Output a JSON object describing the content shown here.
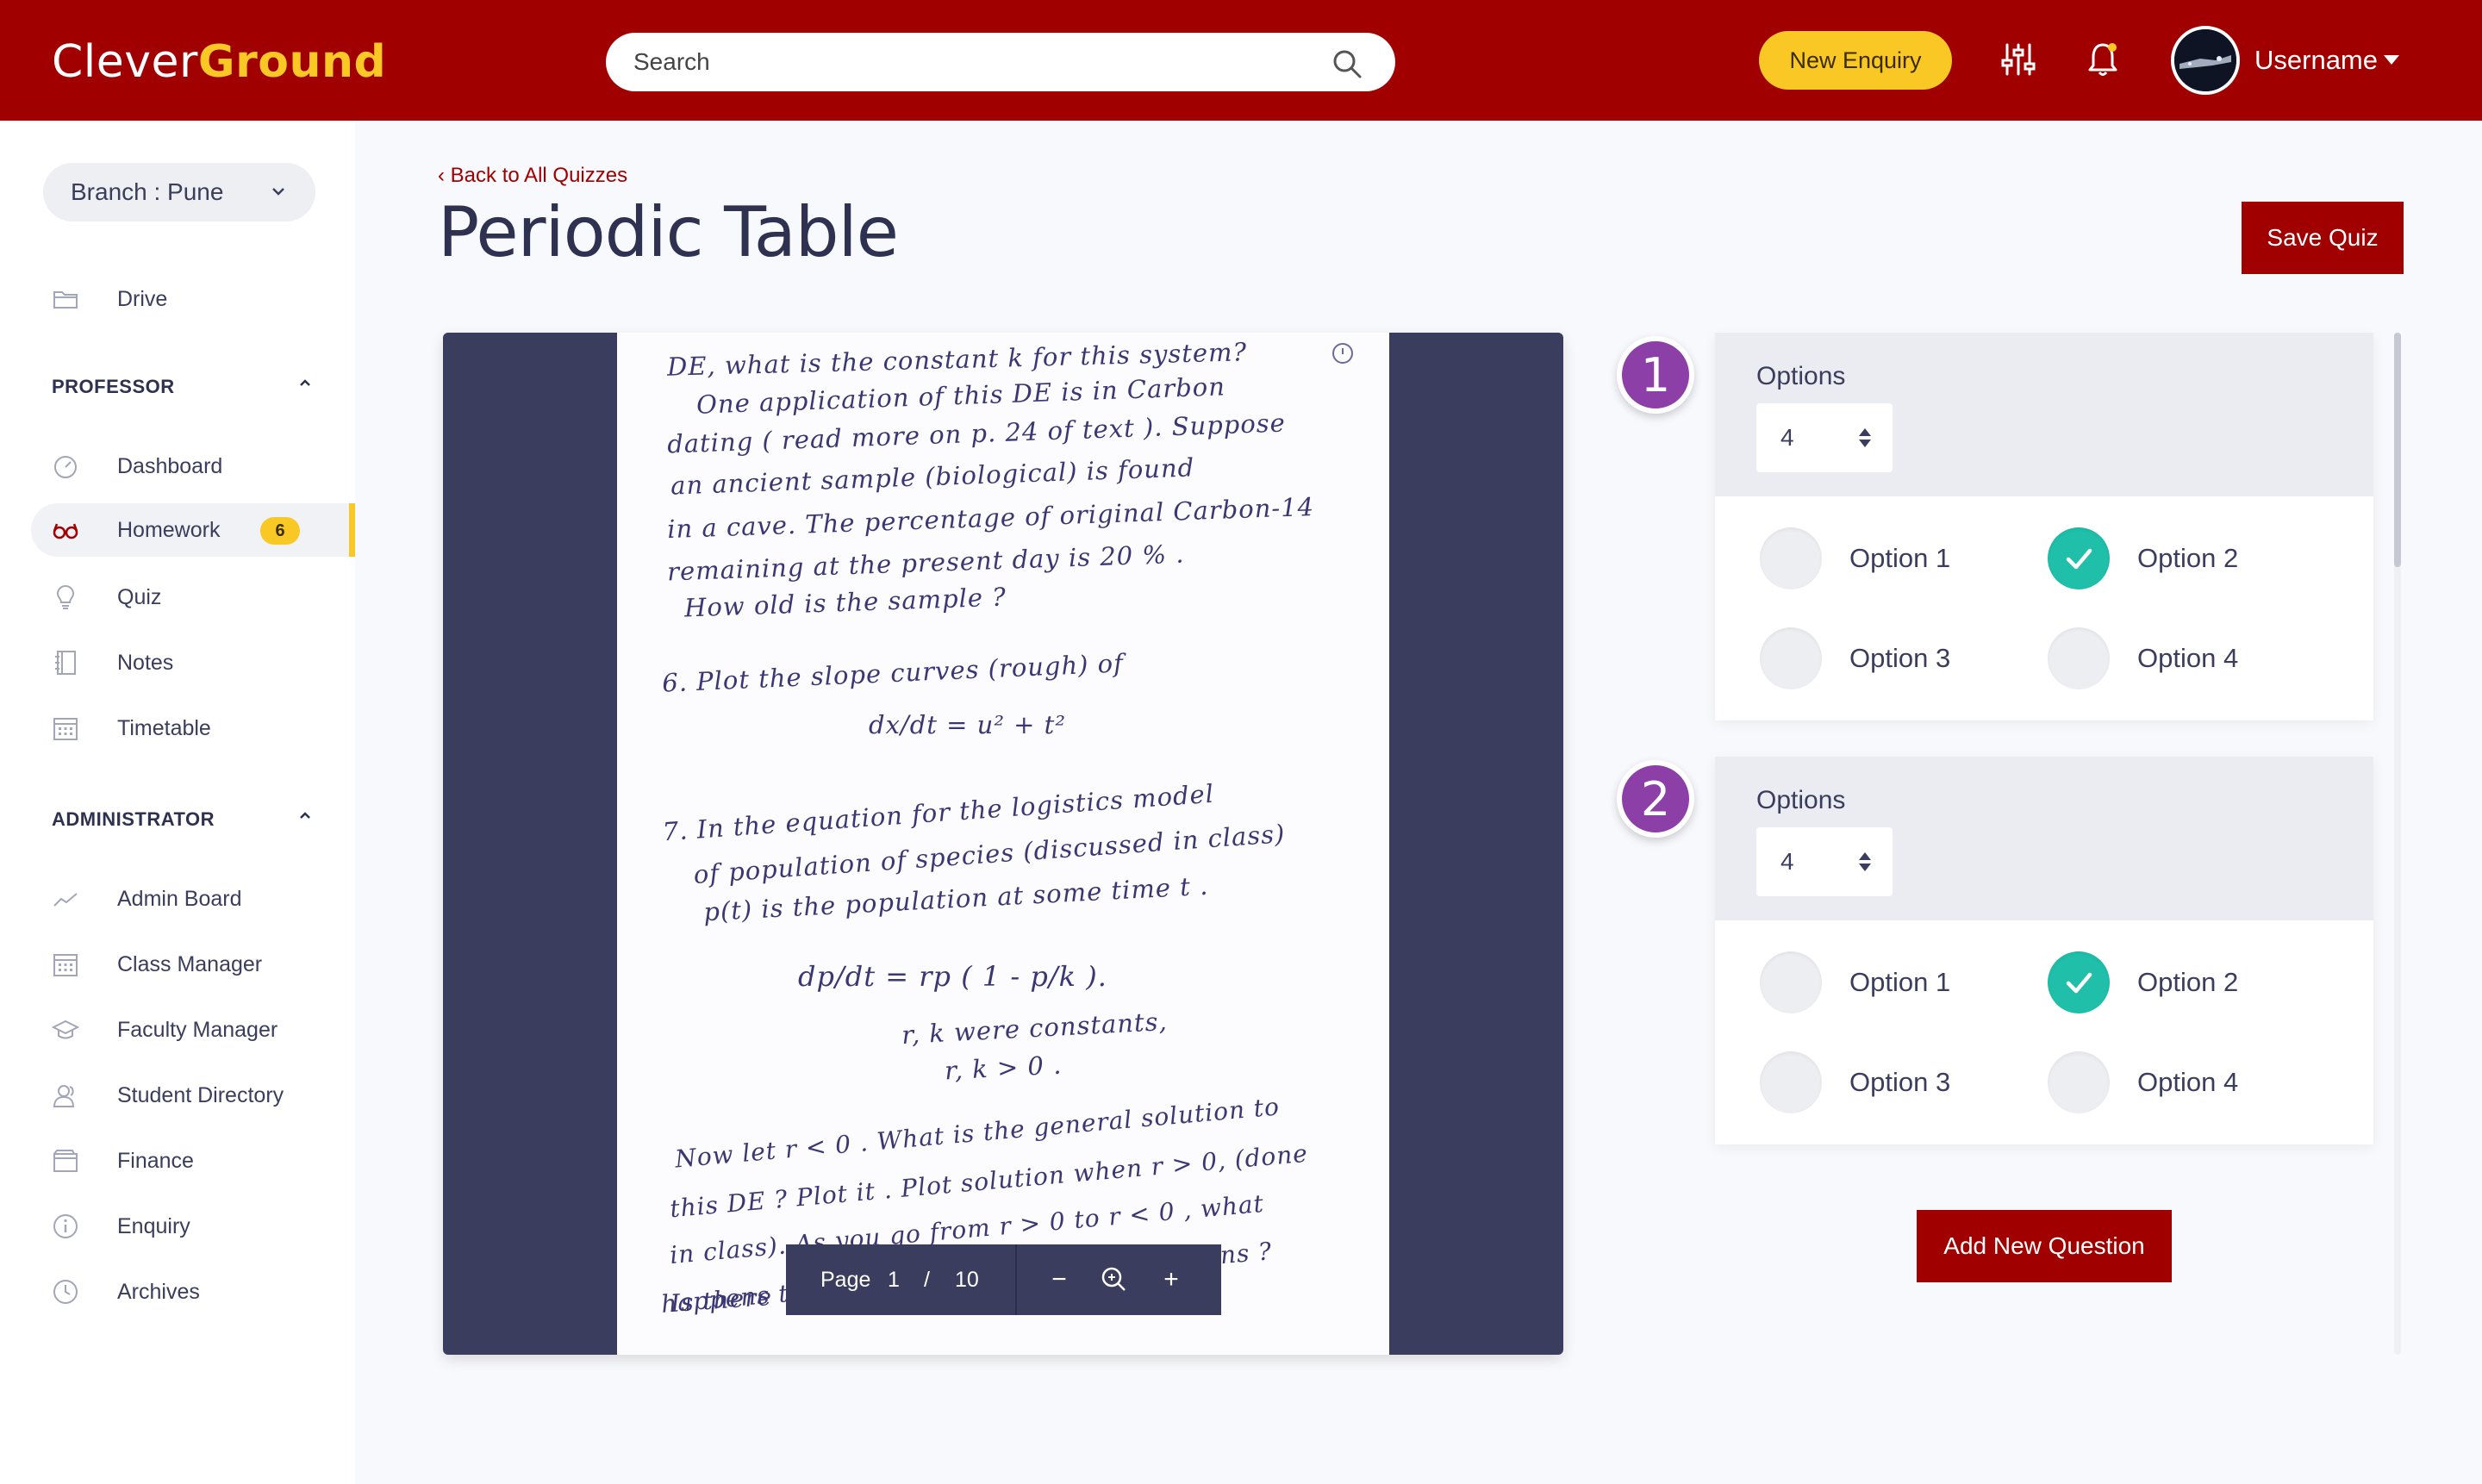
{
  "header": {
    "logo_part1": "Clever",
    "logo_part2": "Ground",
    "search_placeholder": "Search",
    "new_enquiry_label": "New Enquiry",
    "username": "Username"
  },
  "sidebar": {
    "branch_label": "Branch : Pune",
    "drive_label": "Drive",
    "professor_heading": "PROFESSOR",
    "professor_items": [
      {
        "label": "Dashboard",
        "icon": "gauge-icon"
      },
      {
        "label": "Homework",
        "icon": "glasses-icon",
        "badge": "6",
        "active": true
      },
      {
        "label": "Quiz",
        "icon": "lightbulb-icon"
      },
      {
        "label": "Notes",
        "icon": "notebook-icon"
      },
      {
        "label": "Timetable",
        "icon": "calendar-icon"
      }
    ],
    "administrator_heading": "ADMINISTRATOR",
    "admin_items": [
      {
        "label": "Admin Board",
        "icon": "trend-icon"
      },
      {
        "label": "Class Manager",
        "icon": "calendar-grid-icon"
      },
      {
        "label": "Faculty Manager",
        "icon": "graduation-cap-icon"
      },
      {
        "label": "Student Directory",
        "icon": "users-icon"
      },
      {
        "label": "Finance",
        "icon": "wallet-icon"
      },
      {
        "label": "Enquiry",
        "icon": "info-icon"
      },
      {
        "label": "Archives",
        "icon": "clock-icon"
      }
    ]
  },
  "main": {
    "back_link": "Back to All Quizzes",
    "title": "Periodic Table",
    "save_label": "Save Quiz",
    "add_question_label": "Add New Question"
  },
  "viewer": {
    "page_label": "Page",
    "current_page": "1",
    "page_sep": "/",
    "total_pages": "10",
    "handwriting": [
      "DE,  what  is  the  constant  k  for  this  system?",
      "One  application  of  this  DE  is  in  Carbon",
      "dating  ( read  more  on p. 24  of  text ).  Suppose",
      "an  ancient  sample  (biological)  is  found",
      "in a  cave.  The  percentage  of  original  Carbon-14",
      "remaining  at  the  present  day  is  20 % .",
      "How  old  is  the  sample ?",
      "6.      Plot  the    slope  curves   (rough)   of",
      "dx/dt  =  u² + t²",
      "7.   In   the  equation   for  the   logistics  model",
      "of  population   of  species   (discussed  in  class)",
      "p(t)  is  the  population    at  some  time t .",
      "dp/dt   =   rp  ( 1 - p/k ).",
      "r, k    were  constants,",
      "r, k > 0 .",
      "Now   let   r < 0 .   What  is the general  solution  to",
      "this  DE ?   Plot  it .   Plot  solution   when  r > 0, (done",
      "in class).   As  you  go   from   r > 0  to  r < 0 ,  what",
      "happens   to  qualitative  behaviour   of  solutions ?",
      "Is  there"
    ]
  },
  "questions": [
    {
      "number": "1",
      "options_label": "Options",
      "options_count": "4",
      "options": [
        {
          "label": "Option 1",
          "checked": false
        },
        {
          "label": "Option 2",
          "checked": true
        },
        {
          "label": "Option 3",
          "checked": false
        },
        {
          "label": "Option 4",
          "checked": false
        }
      ]
    },
    {
      "number": "2",
      "options_label": "Options",
      "options_count": "4",
      "options": [
        {
          "label": "Option 1",
          "checked": false
        },
        {
          "label": "Option 2",
          "checked": true
        },
        {
          "label": "Option 3",
          "checked": false
        },
        {
          "label": "Option 4",
          "checked": false
        }
      ]
    }
  ],
  "colors": {
    "brand_red": "#a00000",
    "accent_yellow": "#f9c824",
    "check_teal": "#1fbfaa",
    "number_purple": "#8d3fa8",
    "viewer_navy": "#3b3d5e"
  }
}
